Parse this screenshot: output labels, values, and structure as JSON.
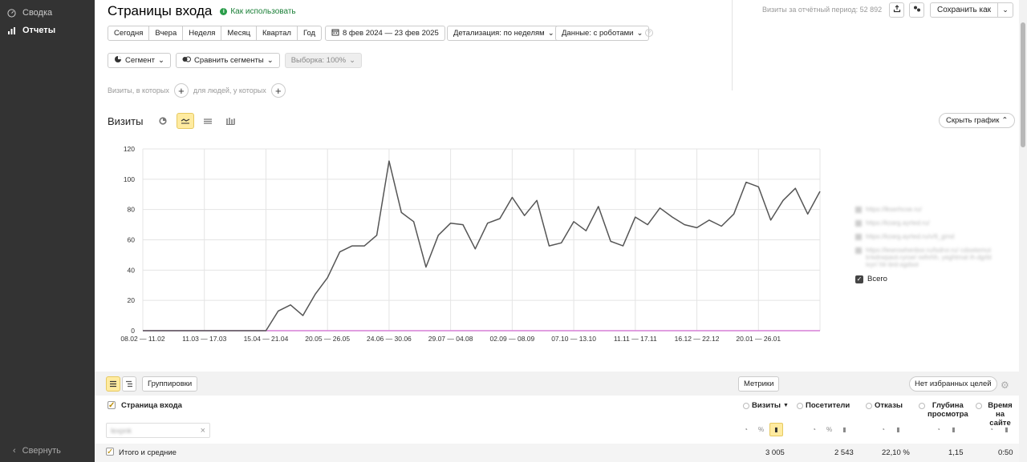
{
  "sidebar": {
    "items": [
      {
        "label": "Сводка",
        "icon": "gauge-icon"
      },
      {
        "label": "Отчеты",
        "icon": "bar-chart-icon"
      }
    ],
    "collapse_label": "Свернуть"
  },
  "header": {
    "title": "Страницы входа",
    "how_to": "Как использовать",
    "visits_period": "Визиты за отчётный период: 52 892",
    "save_as": "Сохранить как"
  },
  "periods": [
    "Сегодня",
    "Вчера",
    "Неделя",
    "Месяц",
    "Квартал",
    "Год"
  ],
  "date_range": "8 фев 2024 — 23 фев 2025",
  "detail": "Детализация: по неделям",
  "data_mode": "Данные: с роботами",
  "segment": "Сегмент",
  "compare": "Сравнить сегменты",
  "sample": "Выборка: 100%",
  "conditions": {
    "visits_where": "Визиты, в которых",
    "people_where": "для людей, у которых"
  },
  "chart_head": {
    "title": "Визиты",
    "hide_chart": "Скрыть график"
  },
  "legend": {
    "blurred_items": [
      "https://lkserhcoe.ru/",
      "https://kzarg.ayrted.ru/",
      "https://kzarg.ayrted.ru/v/lt_grnd",
      "https://lewrowhenbor.ru/lsdrvr.ru/ cdswtemut tr/edrwpaot-ryroe/ reihrhh, yeghtmat ih-dgrbt ivyr/ hlr-brd-sgdsoi"
    ],
    "total": "Всего"
  },
  "chart_data": {
    "type": "line",
    "ylim": [
      0,
      120
    ],
    "yticks": [
      0,
      20,
      40,
      60,
      80,
      100,
      120
    ],
    "xtick_labels": [
      "08.02 — 11.02",
      "11.03 — 17.03",
      "15.04 — 21.04",
      "20.05 — 26.05",
      "24.06 — 30.06",
      "29.07 — 04.08",
      "02.09 — 08.09",
      "07.10 — 13.10",
      "11.11 — 17.11",
      "16.12 — 22.12",
      "20.01 — 26.01"
    ],
    "xtick_index": [
      0,
      5,
      10,
      15,
      20,
      25,
      30,
      35,
      40,
      45,
      50
    ],
    "series": [
      {
        "color": "#555555",
        "values": [
          0,
          0,
          0,
          0,
          0,
          0,
          0,
          0,
          0,
          0,
          0,
          13,
          17,
          10,
          24,
          35,
          52,
          56,
          56,
          63,
          112,
          78,
          72,
          42,
          63,
          71,
          70,
          54,
          71,
          74,
          88,
          76,
          86,
          56,
          58,
          72,
          66,
          82,
          59,
          56,
          75,
          70,
          81,
          75,
          70,
          68,
          73,
          69,
          77,
          98,
          95,
          73,
          86,
          94,
          77,
          92
        ]
      },
      {
        "color": "#d67fd6",
        "values": [
          0,
          0,
          0,
          0,
          0,
          0,
          0,
          0,
          0,
          0,
          0,
          0,
          0,
          0,
          0,
          0,
          0,
          0,
          0,
          0,
          0,
          0,
          0,
          0,
          0,
          0,
          0,
          0,
          0,
          0,
          0,
          0,
          0,
          0,
          0,
          0,
          0,
          0,
          0,
          0,
          0,
          0,
          0,
          0,
          0,
          0,
          0,
          0,
          0,
          0,
          0,
          0,
          0,
          0,
          0,
          0
        ]
      }
    ]
  },
  "table": {
    "groupings": "Группировки",
    "metrics": "Метрики",
    "no_goals": "Нет избранных целей",
    "dimension_head": "Страница входа",
    "search_placeholder": "lexpnk",
    "columns": [
      "Визиты",
      "Посетители",
      "Отказы",
      "Глубина просмотра",
      "Время на сайте"
    ],
    "total_label": "Итого и средние",
    "totals": [
      "3 005",
      "2 543",
      "22,10 %",
      "1,15",
      "0:50"
    ]
  }
}
